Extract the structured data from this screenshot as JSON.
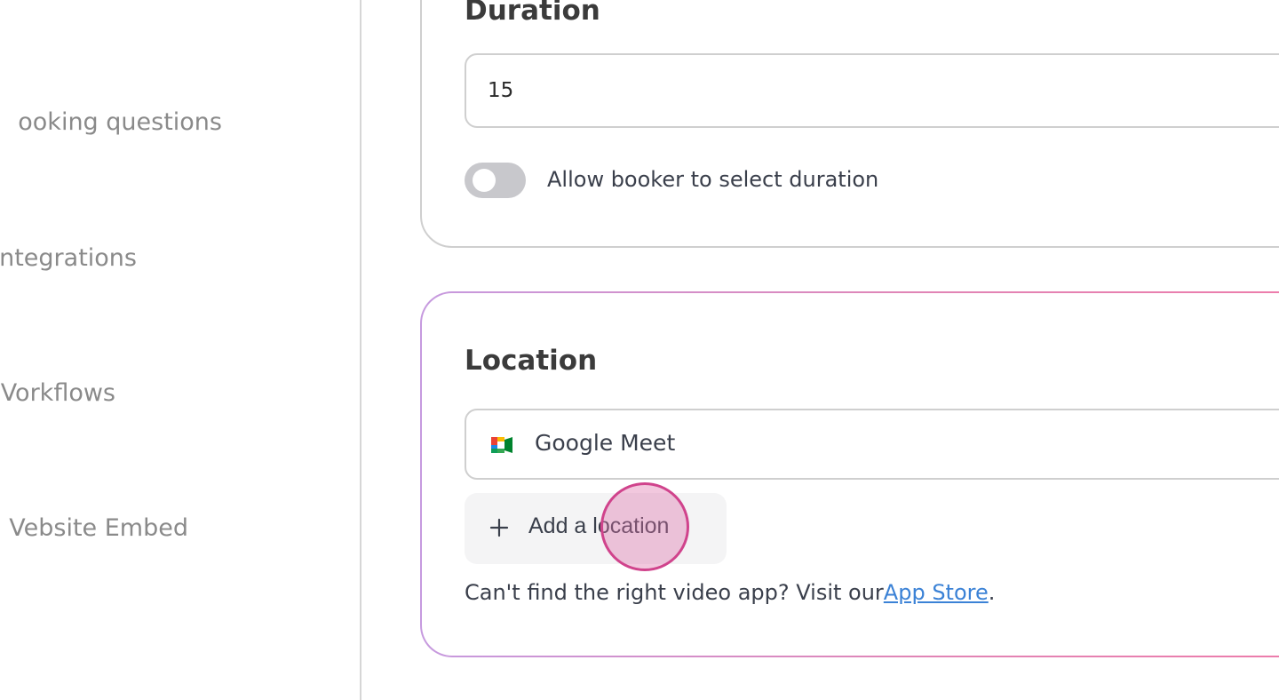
{
  "sidebar": {
    "items": [
      {
        "label": "ooking questions"
      },
      {
        "label": "ntegrations"
      },
      {
        "label": "Vorkflows"
      },
      {
        "label": "Vebsite Embed"
      }
    ]
  },
  "duration": {
    "title": "Duration",
    "value": "15",
    "toggle_label": "Allow booker to select duration",
    "toggle_on": false
  },
  "location": {
    "title": "Location",
    "selected": "Google Meet",
    "selected_icon": "google-meet-icon",
    "add_button_label": "Add a location",
    "add_button_icon": "plus-icon",
    "help_prefix": "Can't find the right video app? Visit our",
    "help_link": "App Store",
    "help_suffix": "."
  },
  "colors": {
    "link": "#3b82d6",
    "text": "#3a3f4b",
    "muted": "#8a8a8a",
    "toggle_off": "#c8c8cc",
    "click_indicator": "#d0438c"
  }
}
